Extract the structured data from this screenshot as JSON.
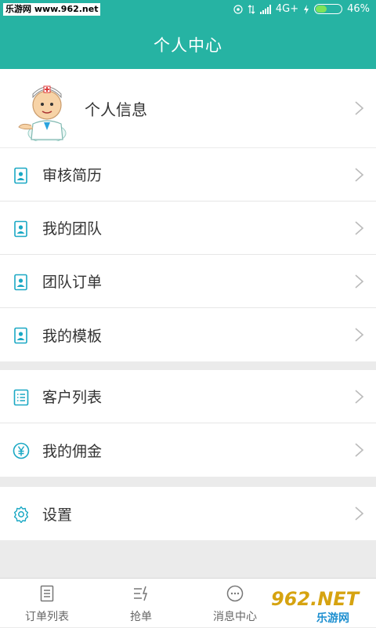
{
  "status_bar": {
    "watermark": "乐游网 www.962.net",
    "network": "4G+",
    "battery": "46%",
    "battery_level": 0.46
  },
  "header": {
    "title": "个人中心"
  },
  "profile": {
    "label": "个人信息"
  },
  "menu_group_1": [
    {
      "label": "审核简历",
      "icon": "document-icon"
    },
    {
      "label": "我的团队",
      "icon": "document-icon"
    },
    {
      "label": "团队订单",
      "icon": "document-icon"
    },
    {
      "label": "我的模板",
      "icon": "document-icon"
    }
  ],
  "menu_group_2": [
    {
      "label": "客户列表",
      "icon": "list-icon"
    },
    {
      "label": "我的佣金",
      "icon": "yen-icon"
    }
  ],
  "menu_group_3": [
    {
      "label": "设置",
      "icon": "gear-icon"
    }
  ],
  "tabbar": {
    "items": [
      {
        "label": "订单列表",
        "icon": "order-list-icon"
      },
      {
        "label": "抢单",
        "icon": "grab-order-icon"
      },
      {
        "label": "消息中心",
        "icon": "message-icon"
      }
    ]
  },
  "overlay_watermark": {
    "logo": "962.NET",
    "text": "乐游网"
  },
  "colors": {
    "brand": "#26b3a3",
    "icon_accent": "#1aa8c4",
    "background": "#ebebeb"
  }
}
